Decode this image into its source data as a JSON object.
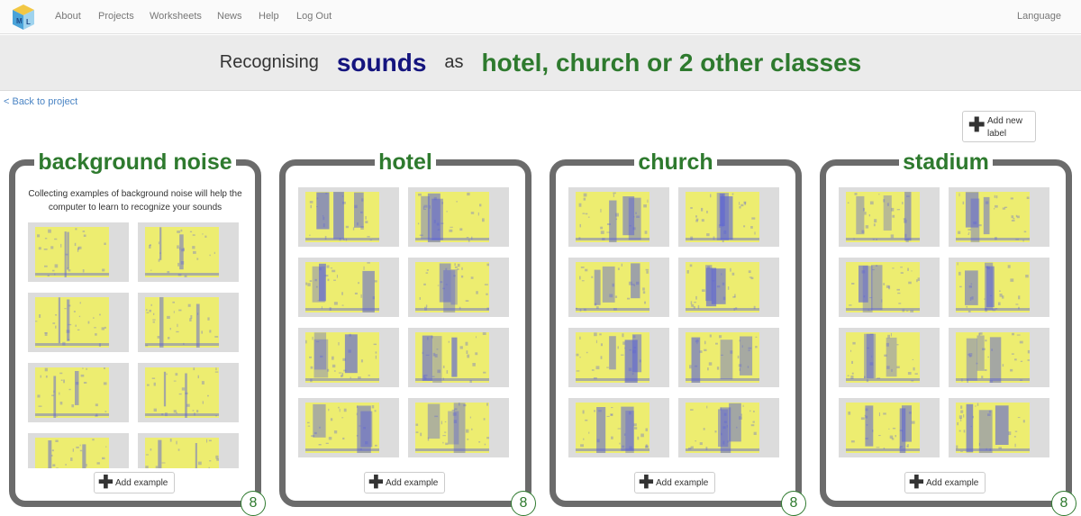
{
  "nav": {
    "links": [
      "About",
      "Projects",
      "Worksheets",
      "News",
      "Help",
      "Log Out"
    ],
    "language": "Language"
  },
  "title": {
    "prefix": "Recognising",
    "type": "sounds",
    "as": "as",
    "classes": "hotel, church or 2 other classes"
  },
  "back_link": "< Back to project",
  "add_label": {
    "label": "Add new label",
    "icon": "plus-icon"
  },
  "colors": {
    "title_green": "#2e7a2e",
    "title_navy": "#14147e",
    "card_border": "#6b6b6b",
    "spectrogram_yellow": "#eded70",
    "spectrogram_blue": "#5b62d6"
  },
  "labels": [
    {
      "name": "background noise",
      "description": "Collecting examples of background noise will help the computer to learn to recognize your sounds",
      "count": 8,
      "add_example": "Add example"
    },
    {
      "name": "hotel",
      "description": "",
      "count": 8,
      "add_example": "Add example"
    },
    {
      "name": "church",
      "description": "",
      "count": 8,
      "add_example": "Add example"
    },
    {
      "name": "stadium",
      "description": "",
      "count": 8,
      "add_example": "Add example"
    }
  ]
}
